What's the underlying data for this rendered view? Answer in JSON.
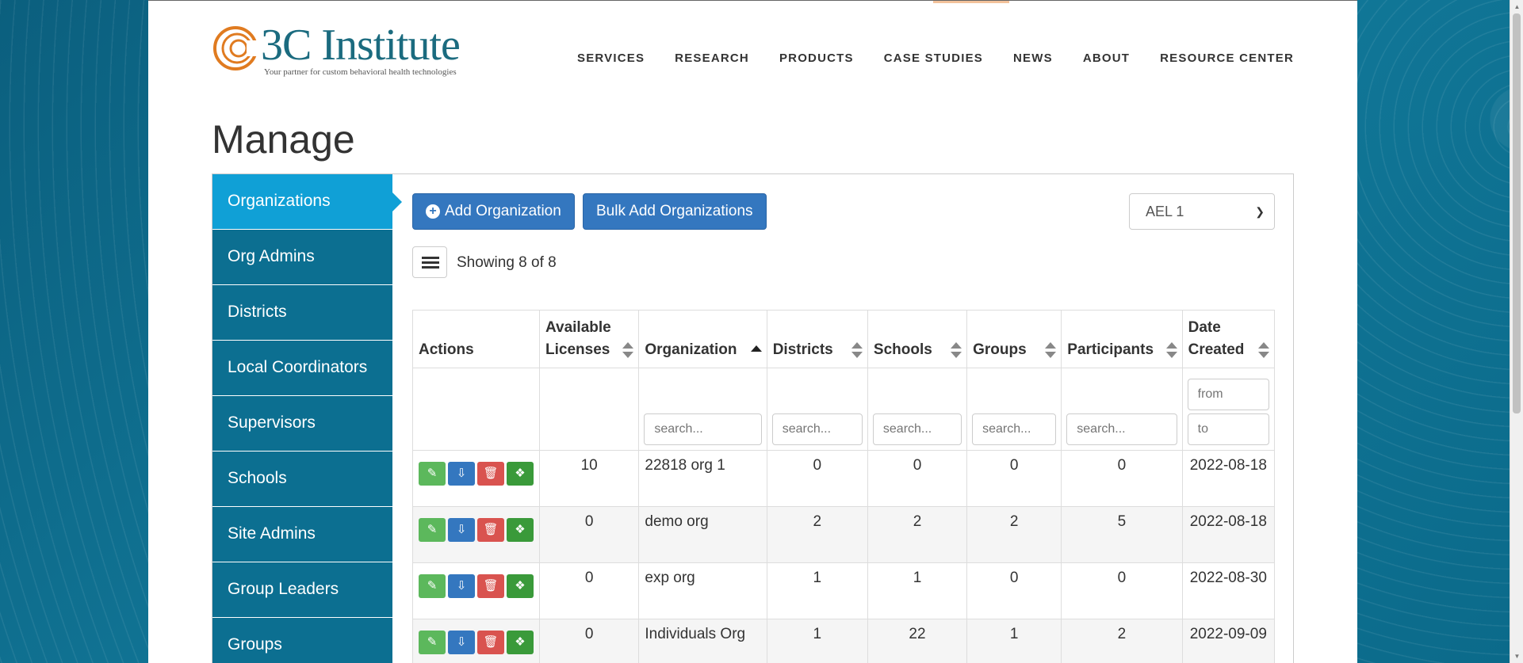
{
  "brand": {
    "name": "3C Institute",
    "tagline": "Your partner for custom behavioral health technologies",
    "colors": {
      "primary": "#1b6b7f",
      "accent": "#e07b20"
    }
  },
  "nav": [
    "SERVICES",
    "RESEARCH",
    "PRODUCTS",
    "CASE STUDIES",
    "NEWS",
    "ABOUT",
    "RESOURCE CENTER"
  ],
  "page_title": "Manage",
  "sidebar": {
    "items": [
      {
        "label": "Organizations",
        "active": true
      },
      {
        "label": "Org Admins",
        "active": false
      },
      {
        "label": "Districts",
        "active": false
      },
      {
        "label": "Local Coordinators",
        "active": false
      },
      {
        "label": "Supervisors",
        "active": false
      },
      {
        "label": "Schools",
        "active": false
      },
      {
        "label": "Site Admins",
        "active": false
      },
      {
        "label": "Group Leaders",
        "active": false
      },
      {
        "label": "Groups",
        "active": false
      }
    ]
  },
  "toolbar": {
    "add_label": "Add Organization",
    "bulk_add_label": "Bulk Add Organizations",
    "select_value": "AEL 1"
  },
  "showing": "Showing 8 of 8",
  "table": {
    "headers": {
      "actions": "Actions",
      "licenses": "Available Licenses",
      "organization": "Organization",
      "districts": "Districts",
      "schools": "Schools",
      "groups": "Groups",
      "participants": "Participants",
      "date_created": "Date Created"
    },
    "filters": {
      "search_placeholder": "search...",
      "from_placeholder": "from",
      "to_placeholder": "to"
    },
    "rows": [
      {
        "licenses": "10",
        "organization": "22818 org 1",
        "districts": "0",
        "schools": "0",
        "groups": "0",
        "participants": "0",
        "date": "2022-08-18"
      },
      {
        "licenses": "0",
        "organization": "demo org",
        "districts": "2",
        "schools": "2",
        "groups": "2",
        "participants": "5",
        "date": "2022-08-18"
      },
      {
        "licenses": "0",
        "organization": "exp org",
        "districts": "1",
        "schools": "1",
        "groups": "0",
        "participants": "0",
        "date": "2022-08-30"
      },
      {
        "licenses": "0",
        "organization": "Individuals Org",
        "districts": "1",
        "schools": "22",
        "groups": "1",
        "participants": "2",
        "date": "2022-09-09"
      }
    ]
  },
  "icons": {
    "edit": "pencil-icon",
    "export": "download-box-icon",
    "delete": "trash-icon",
    "puzzle": "puzzle-icon"
  }
}
